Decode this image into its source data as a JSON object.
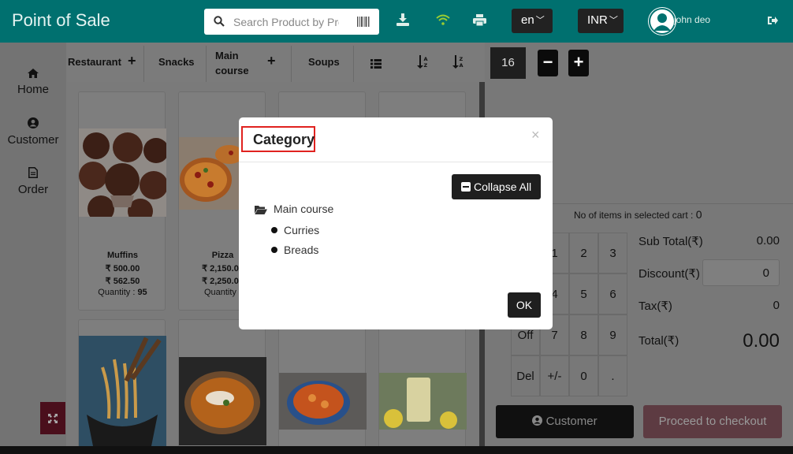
{
  "header": {
    "app_title": "Point of Sale",
    "search_placeholder": "Search Product by Product",
    "language": "en",
    "currency": "INR",
    "user_name": "john deo"
  },
  "nav": {
    "items": [
      {
        "label": "Home",
        "icon": "home-icon"
      },
      {
        "label": "Customer",
        "icon": "user-circle-icon"
      },
      {
        "label": "Order",
        "icon": "document-icon"
      }
    ]
  },
  "categories": {
    "tabs": [
      {
        "label": "Restaurant",
        "has_plus": true
      },
      {
        "label": "Snacks",
        "has_plus": false
      },
      {
        "label": "Main course",
        "has_plus": true
      },
      {
        "label": "Soups",
        "has_plus": false
      }
    ]
  },
  "products": [
    {
      "name": "Muffins",
      "price": "₹ 500.00",
      "price2": "₹ 562.50",
      "qty_label": "Quantity :",
      "qty": "95"
    },
    {
      "name": "Pizza",
      "price": "₹ 2,150.00",
      "price2": "₹ 2,250.00",
      "qty_label": "Quantity :",
      "qty": ""
    }
  ],
  "cart": {
    "quantity": "16",
    "items_label": "No of items in selected cart :",
    "items_count": "0"
  },
  "keypad": {
    "keys": [
      "1",
      "2",
      "3",
      "4",
      "5",
      "6",
      "Off",
      "7",
      "8",
      "9",
      "Del",
      "+/-",
      "0",
      "."
    ]
  },
  "totals": {
    "subtotal_label": "Sub Total(₹)",
    "subtotal_value": "0.00",
    "discount_label": "Discount(₹)",
    "discount_value": "0",
    "tax_label": "Tax(₹)",
    "tax_value": "0",
    "total_label": "Total(₹)",
    "total_value": "0.00"
  },
  "actions": {
    "customer_label": "Customer",
    "checkout_label": "Proceed to checkout"
  },
  "modal": {
    "title": "Category",
    "close": "×",
    "collapse_label": "Collapse All",
    "tree": {
      "root": "Main course",
      "children": [
        "Curries",
        "Breads"
      ]
    },
    "ok_label": "OK"
  },
  "colors": {
    "header": "#00706f",
    "accent_dark": "#1f1f1f",
    "checkout": "#5d3b42",
    "highlight": "#e0221f"
  }
}
